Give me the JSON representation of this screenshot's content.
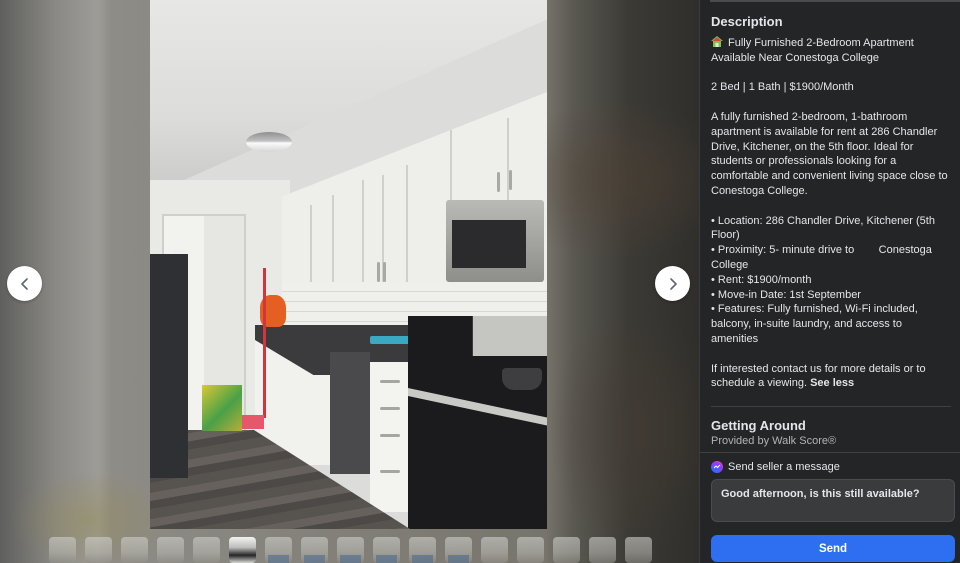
{
  "viewer": {
    "prev_icon": "chevron-left-icon",
    "next_icon": "chevron-right-icon",
    "thumbnail_count": 17,
    "active_thumbnail_index": 5,
    "blue_thumbnails": [
      6,
      7,
      8,
      9,
      10,
      11
    ]
  },
  "description": {
    "title": "Description",
    "headline_icon": "house-icon",
    "headline": "Fully Furnished 2-Bedroom Apartment Available Near Conestoga College",
    "summary": "2 Bed | 1 Bath | $1900/Month",
    "body": "A fully furnished 2-bedroom, 1-bathroom apartment is available for rent at 286 Chandler Drive, Kitchener, on the 5th floor. Ideal for students or professionals looking for a comfortable and convenient living space close to Conestoga College.",
    "bullets": [
      "• Location: 286 Chandler Drive, Kitchener (5th Floor)",
      "• Proximity: 5- minute drive to        Conestoga College",
      "• Rent: $1900/month",
      "• Move-in Date: 1st September",
      "• Features: Fully furnished, Wi-Fi included, balcony, in-suite laundry, and access to amenities"
    ],
    "closing": "If interested contact us for more details or to schedule a viewing.",
    "see_less": "See less"
  },
  "getting_around": {
    "title": "Getting Around",
    "provider": "Provided by Walk Score®",
    "walk_score_label": "Walk Score®"
  },
  "message": {
    "icon": "messenger-icon",
    "label": "Send seller a message",
    "value": "Good afternoon, is this still available?",
    "send_label": "Send",
    "send_color": "#2d6ff0"
  }
}
